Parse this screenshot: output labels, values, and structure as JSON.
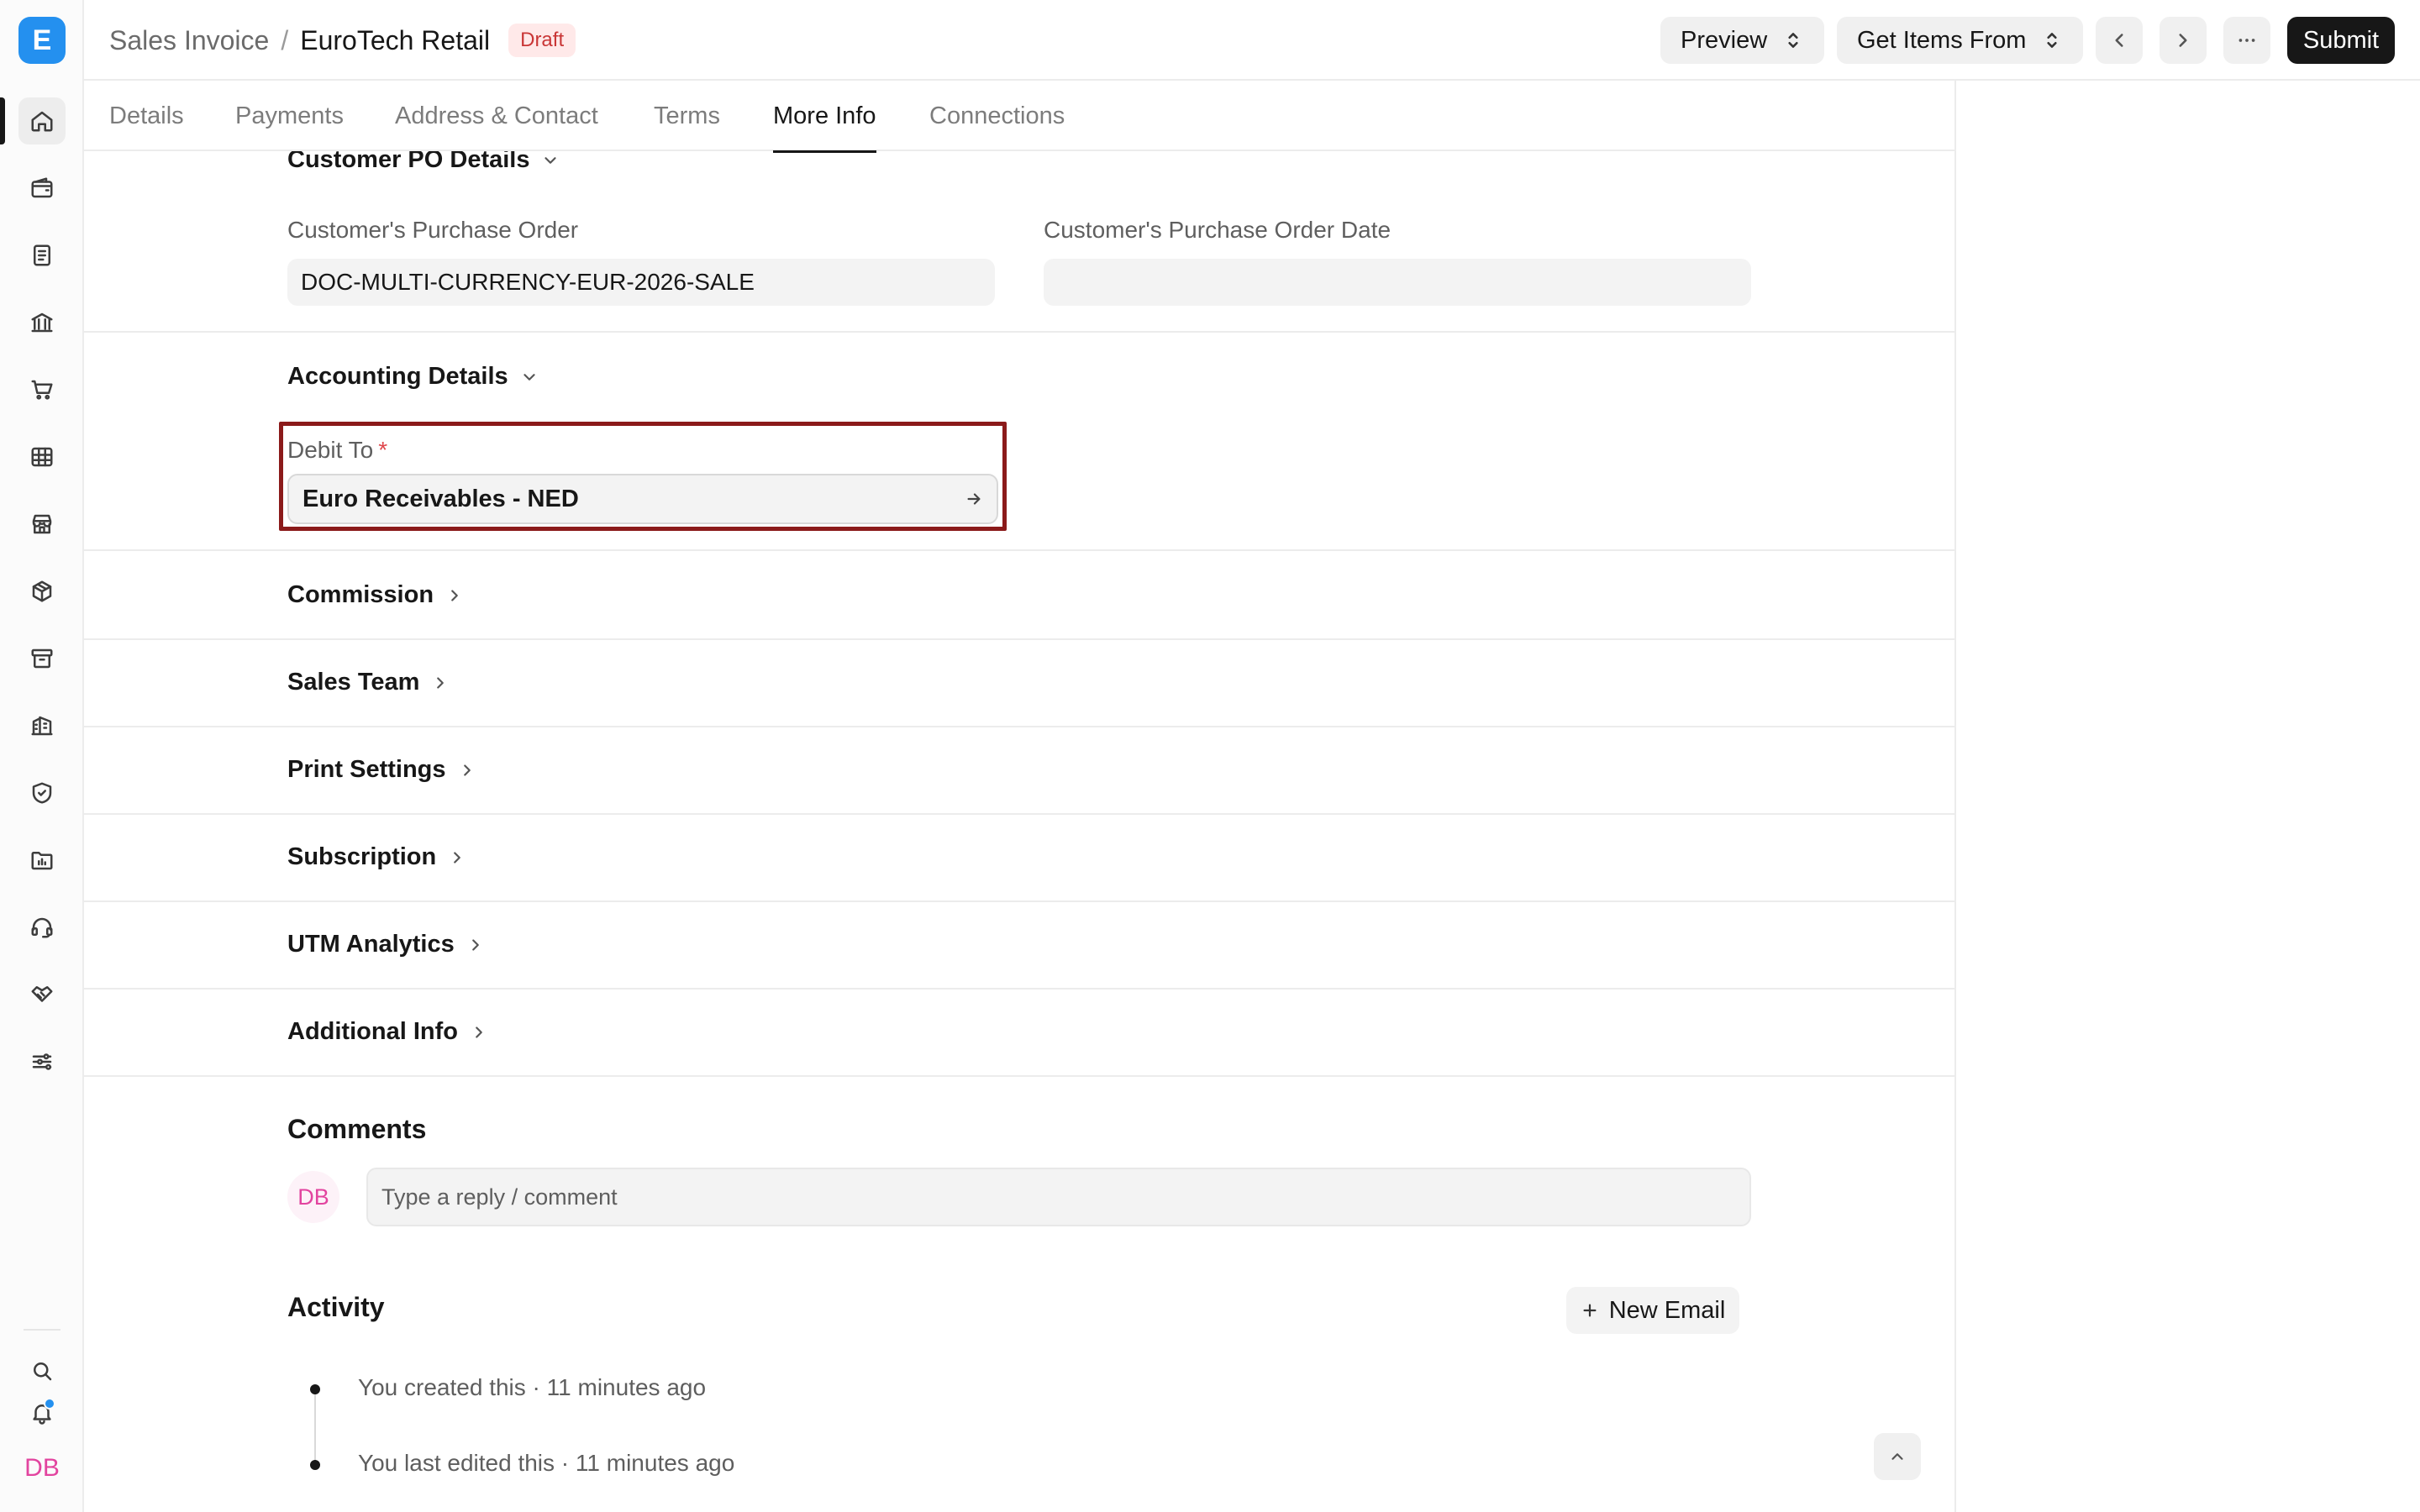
{
  "app": {
    "logo_letter": "E",
    "accent_color": "#2490ef",
    "rail_icons": [
      "home-icon",
      "wallet-icon",
      "receipt-icon",
      "bank-icon",
      "cart-icon",
      "table-icon",
      "store-icon",
      "package-icon",
      "archive-icon",
      "building-icon",
      "shield-icon",
      "folder-chart-icon",
      "headset-icon",
      "handshake-icon",
      "sliders-icon"
    ],
    "bottom_icons": [
      "search-icon",
      "bell-icon"
    ],
    "user_initials": "DB"
  },
  "header": {
    "doctype": "Sales Invoice",
    "separator": "/",
    "title": "EuroTech Retail",
    "status": "Draft",
    "preview_label": "Preview",
    "get_items_label": "Get Items From",
    "submit_label": "Submit"
  },
  "tabs": [
    {
      "label": "Details"
    },
    {
      "label": "Payments"
    },
    {
      "label": "Address & Contact"
    },
    {
      "label": "Terms"
    },
    {
      "label": "More Info",
      "active": true
    },
    {
      "label": "Connections"
    }
  ],
  "customer_po": {
    "section_label": "Customer PO Details",
    "po_label": "Customer's Purchase Order",
    "po_value": "DOC-MULTI-CURRENCY-EUR-2026-SALE",
    "po_date_label": "Customer's Purchase Order Date",
    "po_date_value": ""
  },
  "accounting": {
    "section_label": "Accounting Details",
    "debit_to_label": "Debit To",
    "required_mark": "*",
    "debit_to_value": "Euro Receivables - NED"
  },
  "collapsed_sections": [
    {
      "label": "Commission"
    },
    {
      "label": "Sales Team"
    },
    {
      "label": "Print Settings"
    },
    {
      "label": "Subscription"
    },
    {
      "label": "UTM Analytics"
    },
    {
      "label": "Additional Info"
    }
  ],
  "comments": {
    "title": "Comments",
    "avatar_initials": "DB",
    "placeholder": "Type a reply / comment"
  },
  "activity": {
    "title": "Activity",
    "new_email_label": "New Email",
    "items": [
      {
        "text": "You created this · 11 minutes ago"
      },
      {
        "text": "You last edited this · 11 minutes ago"
      }
    ]
  }
}
